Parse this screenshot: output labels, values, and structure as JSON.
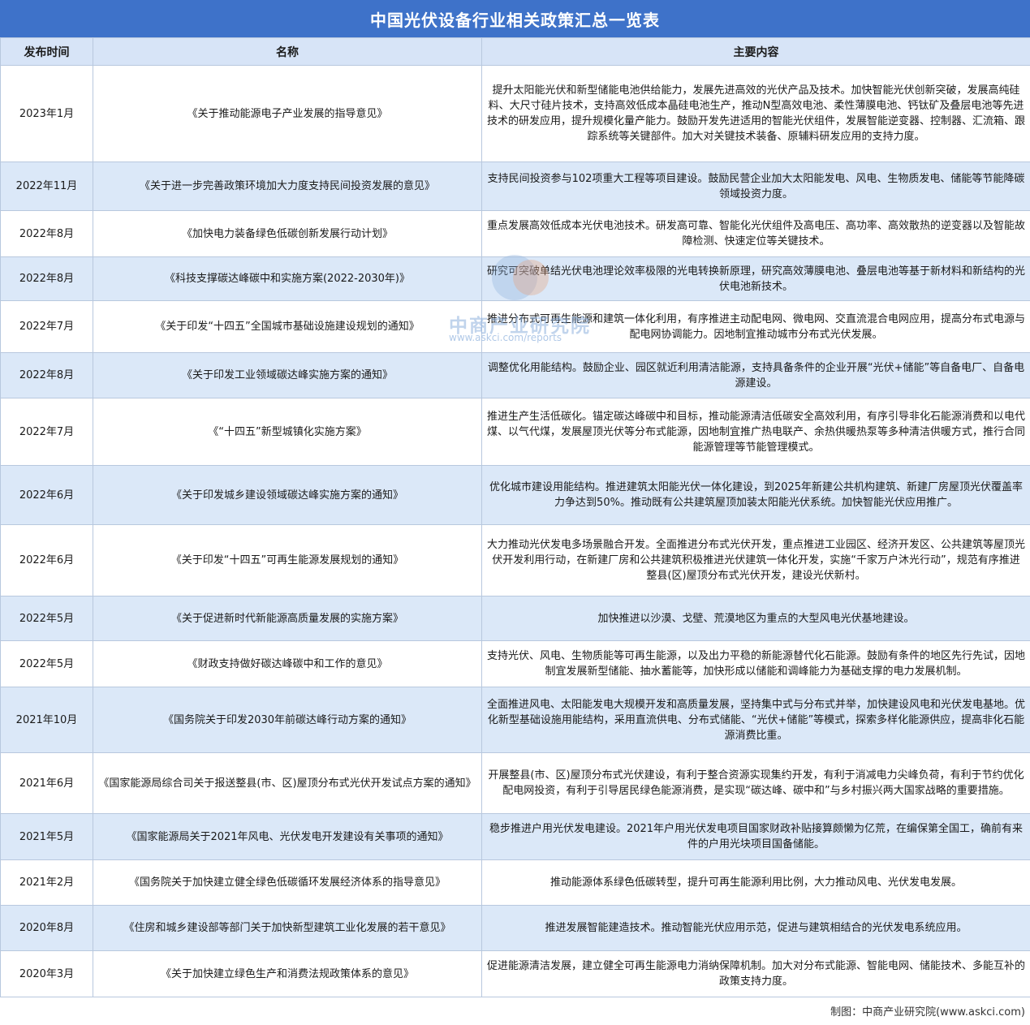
{
  "title": "中国光伏设备行业相关政策汇总一览表",
  "headers": [
    "发布时间",
    "名称",
    "主要内容"
  ],
  "rows": [
    {
      "date": "2023年1月",
      "name": "《关于推动能源电子产业发展的指导意见》",
      "content": "提升太阳能光伏和新型储能电池供给能力，发展先进高效的光伏产品及技术。加快智能光伏创新突破，发展高纯硅料、大尺寸硅片技术，支持高效低成本晶硅电池生产，推动N型高效电池、柔性薄膜电池、钙钛矿及叠层电池等先进技术的研发应用，提升规模化量产能力。鼓励开发先进适用的智能光伏组件，发展智能逆变器、控制器、汇流箱、跟踪系统等关键部件。加大对关键技术装备、原辅料研发应用的支持力度。"
    },
    {
      "date": "2022年11月",
      "name": "《关于进一步完善政策环境加大力度支持民间投资发展的意见》",
      "content": "支持民间投资参与102项重大工程等项目建设。鼓励民营企业加大太阳能发电、风电、生物质发电、储能等节能降碳领域投资力度。"
    },
    {
      "date": "2022年8月",
      "name": "《加快电力装备绿色低碳创新发展行动计划》",
      "content": "重点发展高效低成本光伏电池技术。研发高可靠、智能化光伏组件及高电压、高功率、高效散热的逆变器以及智能故障检测、快速定位等关键技术。"
    },
    {
      "date": "2022年8月",
      "name": "《科技支撑碳达峰碳中和实施方案(2022-2030年)》",
      "content": "研究可突破单结光伏电池理论效率极限的光电转换新原理，研究高效薄膜电池、叠层电池等基于新材料和新结构的光伏电池新技术。"
    },
    {
      "date": "2022年7月",
      "name": "《关于印发“十四五”全国城市基础设施建设规划的通知》",
      "content": "推进分布式可再生能源和建筑一体化利用，有序推进主动配电网、微电网、交直流混合电网应用，提高分布式电源与配电网协调能力。因地制宜推动城市分布式光伏发展。"
    },
    {
      "date": "2022年8月",
      "name": "《关于印发工业领域碳达峰实施方案的通知》",
      "content": "调整优化用能结构。鼓励企业、园区就近利用清洁能源，支持具备条件的企业开展“光伏+储能”等自备电厂、自备电源建设。"
    },
    {
      "date": "2022年7月",
      "name": "《“十四五”新型城镇化实施方案》",
      "content": "推进生产生活低碳化。锚定碳达峰碳中和目标，推动能源清洁低碳安全高效利用，有序引导非化石能源消费和以电代煤、以气代煤，发展屋顶光伏等分布式能源，因地制宜推广热电联产、余热供暖热泵等多种清洁供暖方式，推行合同能源管理等节能管理模式。"
    },
    {
      "date": "2022年6月",
      "name": "《关于印发城乡建设领域碳达峰实施方案的通知》",
      "content": "优化城市建设用能结构。推进建筑太阳能光伏一体化建设，到2025年新建公共机构建筑、新建厂房屋顶光伏覆盖率力争达到50%。推动既有公共建筑屋顶加装太阳能光伏系统。加快智能光伏应用推广。"
    },
    {
      "date": "2022年6月",
      "name": "《关于印发“十四五”可再生能源发展规划的通知》",
      "content": "大力推动光伏发电多场景融合开发。全面推进分布式光伏开发，重点推进工业园区、经济开发区、公共建筑等屋顶光伏开发利用行动，在新建厂房和公共建筑积极推进光伏建筑一体化开发，实施“千家万户沐光行动”，规范有序推进整县(区)屋顶分布式光伏开发，建设光伏新村。"
    },
    {
      "date": "2022年5月",
      "name": "《关于促进新时代新能源高质量发展的实施方案》",
      "content": "加快推进以沙漠、戈壁、荒漠地区为重点的大型风电光伏基地建设。"
    },
    {
      "date": "2022年5月",
      "name": "《财政支持做好碳达峰碳中和工作的意见》",
      "content": "支持光伏、风电、生物质能等可再生能源，以及出力平稳的新能源替代化石能源。鼓励有条件的地区先行先试，因地制宜发展新型储能、抽水蓄能等，加快形成以储能和调峰能力为基础支撑的电力发展机制。"
    },
    {
      "date": "2021年10月",
      "name": "《国务院关于印发2030年前碳达峰行动方案的通知》",
      "content": "全面推进风电、太阳能发电大规模开发和高质量发展，坚持集中式与分布式并举，加快建设风电和光伏发电基地。优化新型基础设施用能结构，采用直流供电、分布式储能、“光伏+储能”等模式，探索多样化能源供应，提高非化石能源消费比重。"
    },
    {
      "date": "2021年6月",
      "name": "《国家能源局综合司关于报送整县(市、区)屋顶分布式光伏开发试点方案的通知》",
      "content": "开展整县(市、区)屋顶分布式光伏建设，有利于整合资源实现集约开发，有利于消减电力尖峰负荷，有利于节约优化配电网投资，有利于引导居民绿色能源消费，是实现“碳达峰、碳中和”与乡村振兴两大国家战略的重要措施。"
    },
    {
      "date": "2021年5月",
      "name": "《国家能源局关于2021年风电、光伏发电开发建设有关事项的通知》",
      "content": "稳步推进户用光伏发电建设。2021年户用光伏发电项目国家财政补贴接算颇懒为亿荒，在编保第全国工，确前有来件的户用光块项目国备储能。"
    },
    {
      "date": "2021年2月",
      "name": "《国务院关于加快建立健全绿色低碳循环发展经济体系的指导意见》",
      "content": "推动能源体系绿色低碳转型，提升可再生能源利用比例，大力推动风电、光伏发电发展。"
    },
    {
      "date": "2020年8月",
      "name": "《住房和城乡建设部等部门关于加快新型建筑工业化发展的若干意见》",
      "content": "推进发展智能建造技术。推动智能光伏应用示范，促进与建筑相结合的光伏发电系统应用。"
    },
    {
      "date": "2020年3月",
      "name": "《关于加快建立绿色生产和消费法规政策体系的意见》",
      "content": "促进能源清洁发展，建立健全可再生能源电力消纳保障机制。加大对分布式能源、智能电网、储能技术、多能互补的政策支持力度。"
    }
  ],
  "watermark": {
    "name": "中商产业研究院",
    "url": "www.askci.com/reports"
  },
  "source": "制图：中商产业研究院(www.askci.com)",
  "colors": {
    "title_bg": "#3e72c9",
    "header_bg": "#d7e4f7",
    "alt_row_bg": "#dbe8f8",
    "border": "#b8c8de"
  }
}
